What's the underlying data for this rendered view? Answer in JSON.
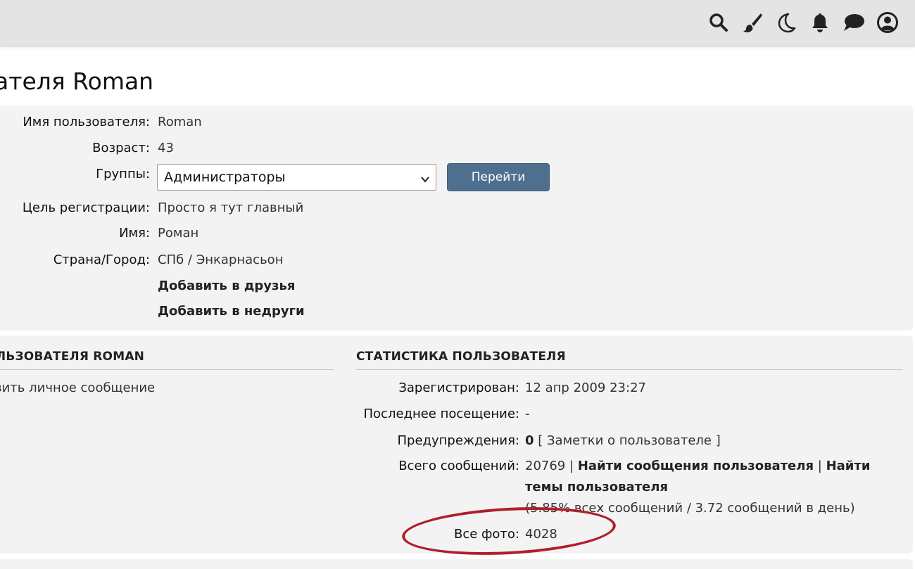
{
  "topbar": {
    "icons": [
      "search-icon",
      "brush-icon",
      "moon-icon",
      "bell-icon",
      "chat-icon",
      "user-circle-icon"
    ]
  },
  "page": {
    "title": "ателя Roman"
  },
  "profile": {
    "username_label": "Имя пользователя:",
    "username_value": "Roman",
    "age_label": "Возраст:",
    "age_value": "43",
    "groups_label": "Группы:",
    "groups_selected": "Администраторы",
    "go_button": "Перейти",
    "reg_goal_label": "Цель регистрации:",
    "reg_goal_value": "Просто я тут главный",
    "name_label": "Имя:",
    "name_value": "Роман",
    "country_label": "Страна/Город:",
    "country_value": "СПб / Энкарнасьон",
    "add_friend": "Добавить в друзья",
    "add_foe": "Добавить в недруги"
  },
  "contact": {
    "header": "ЛЬЗОВАТЕЛЯ ROMAN",
    "pm_link": "вить личное сообщение"
  },
  "stats": {
    "header": "СТАТИСТИКА ПОЛЬЗОВАТЕЛЯ",
    "registered_label": "Зарегистрирован:",
    "registered_value": "12 апр 2009 23:27",
    "last_visit_label": "Последнее посещение:",
    "last_visit_value": "-",
    "warnings_label": "Предупреждения:",
    "warnings_value": "0",
    "notes_link": "[ Заметки о пользователе ]",
    "posts_label": "Всего сообщений:",
    "posts_value": "20769",
    "sep": "|",
    "find_posts": "Найти сообщения пользователя",
    "find_topics_1": "Найти",
    "find_topics_2": "темы пользователя",
    "posts_stats": "(5.85% всех сообщений / 3.72 сообщений в день)",
    "photos_label": "Все фото:",
    "photos_value": "4028"
  },
  "colors": {
    "button_bg": "#4f6f8f",
    "highlight_ellipse": "#b01e2c",
    "panel_bg": "#f3f3f3",
    "topbar_bg": "#e4e4e4"
  }
}
